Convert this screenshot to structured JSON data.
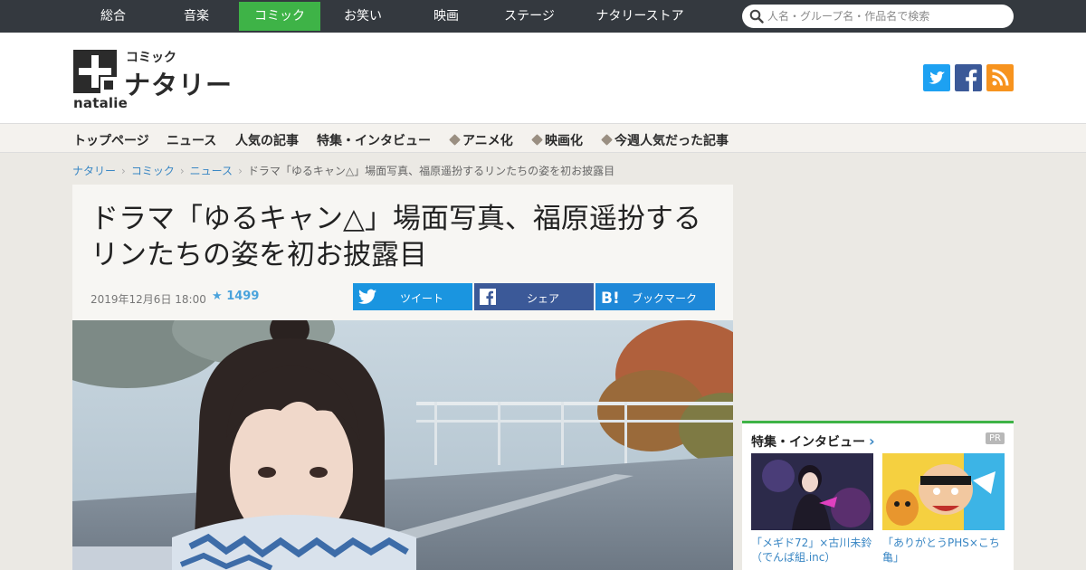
{
  "topnav": {
    "items": [
      "総合",
      "音楽",
      "コミック",
      "お笑い",
      "映画",
      "ステージ",
      "ナタリーストア"
    ],
    "active": "コミック"
  },
  "search": {
    "placeholder": "人名・グループ名・作品名で検索",
    "icon": "search-icon"
  },
  "logo": {
    "sub": "コミック",
    "main": "ナタリー",
    "wordmark": "natalie"
  },
  "social": [
    {
      "name": "twitter-icon",
      "color": "#1da1f2"
    },
    {
      "name": "facebook-icon",
      "color": "#3b5998"
    },
    {
      "name": "rss-icon",
      "color": "#f7931e"
    }
  ],
  "subnav": {
    "items": [
      "トップページ",
      "ニュース",
      "人気の記事",
      "特集・インタビュー",
      "アニメ化",
      "映画化",
      "今週人気だった記事"
    ]
  },
  "breadcrumb": {
    "items": [
      "ナタリー",
      "コミック",
      "ニュース"
    ],
    "current": "ドラマ「ゆるキャン△」場面写真、福原遥扮するリンたちの姿を初お披露目"
  },
  "article": {
    "title": "ドラマ「ゆるキャン△」場面写真、福原遥扮するリンたちの姿を初お披露目",
    "date": "2019年12月6日 18:00",
    "star_count": "1499",
    "buttons": {
      "tweet": "ツイート",
      "share": "シェア",
      "bookmark": "ブックマーク"
    }
  },
  "sidebar": {
    "title": "特集・インタビュー",
    "pr": "PR",
    "items": [
      {
        "caption": "「メギド72」×古川未鈴（でんぱ組.inc）"
      },
      {
        "caption": "「ありがとうPHS×こち亀」"
      }
    ]
  },
  "colors": {
    "topnav_bg": "#34393f",
    "accent_green": "#3eb347",
    "link_blue": "#3a87c4",
    "twitter_blue": "#1a95e0",
    "facebook_blue": "#3b5998",
    "hatena_blue": "#1e88d8"
  }
}
